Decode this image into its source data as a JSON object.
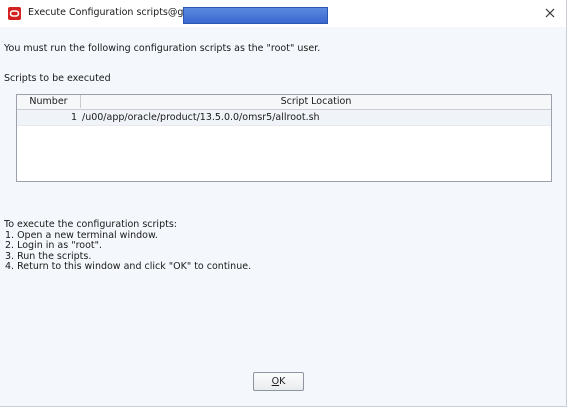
{
  "window": {
    "title": "Execute Configuration scripts@g",
    "close_symbol": "✕"
  },
  "intro_text": "You must run the following configuration scripts as the \"root\" user.",
  "scripts_label": "Scripts to be executed",
  "table": {
    "headers": [
      "Number",
      "Script Location"
    ],
    "rows": [
      {
        "number": "1",
        "location": "/u00/app/oracle/product/13.5.0.0/omsr5/allroot.sh"
      }
    ]
  },
  "instructions": {
    "heading": "To execute the configuration scripts:",
    "steps": [
      "1. Open a new  terminal window.",
      "2. Login in as \"root\".",
      "3. Run the scripts.",
      "4. Return to this window and click \"OK\" to continue."
    ]
  },
  "ok_button": {
    "mnemonic": "O",
    "rest": "K"
  },
  "colors": {
    "oracle_red": "#d2211f",
    "redaction_blue": "#3a68cf"
  }
}
